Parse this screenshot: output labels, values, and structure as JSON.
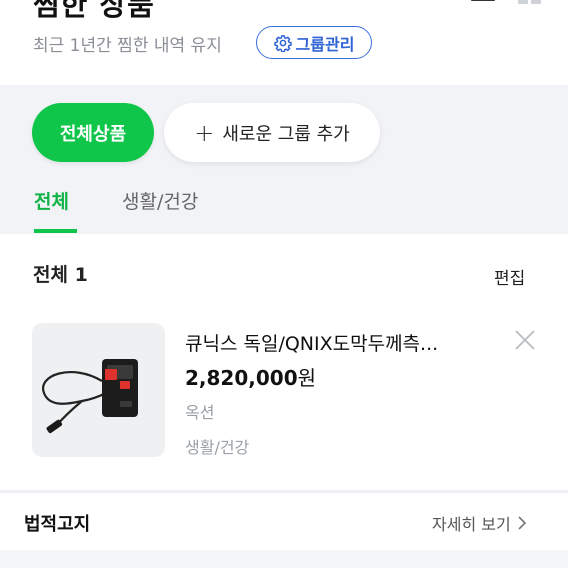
{
  "header": {
    "title": "찜한 상품",
    "subtitle": "최근 1년간 찜한 내역 유지",
    "group_manage_label": "그룹관리",
    "icons": [
      "menu-icon",
      "grid-icon",
      "gear-icon"
    ]
  },
  "group_tabs": {
    "all_label": "전체상품",
    "add_label": "새로운 그룹 추가"
  },
  "category_tabs": [
    {
      "label": "전체",
      "active": true
    },
    {
      "label": "생활/건강",
      "active": false
    }
  ],
  "list": {
    "title": "전체 1",
    "edit_label": "편집",
    "items": [
      {
        "title": "큐닉스 독일/QNIX도막두께측...",
        "price": "2,820,000",
        "price_unit": "원",
        "seller": "옥션",
        "category": "생활/건강"
      }
    ]
  },
  "legal": {
    "title": "법적고지",
    "more_label": "자세히 보기"
  },
  "colors": {
    "accent_green": "#10c64a",
    "link_blue": "#2f63d6",
    "muted_text": "#9aa0a6"
  }
}
